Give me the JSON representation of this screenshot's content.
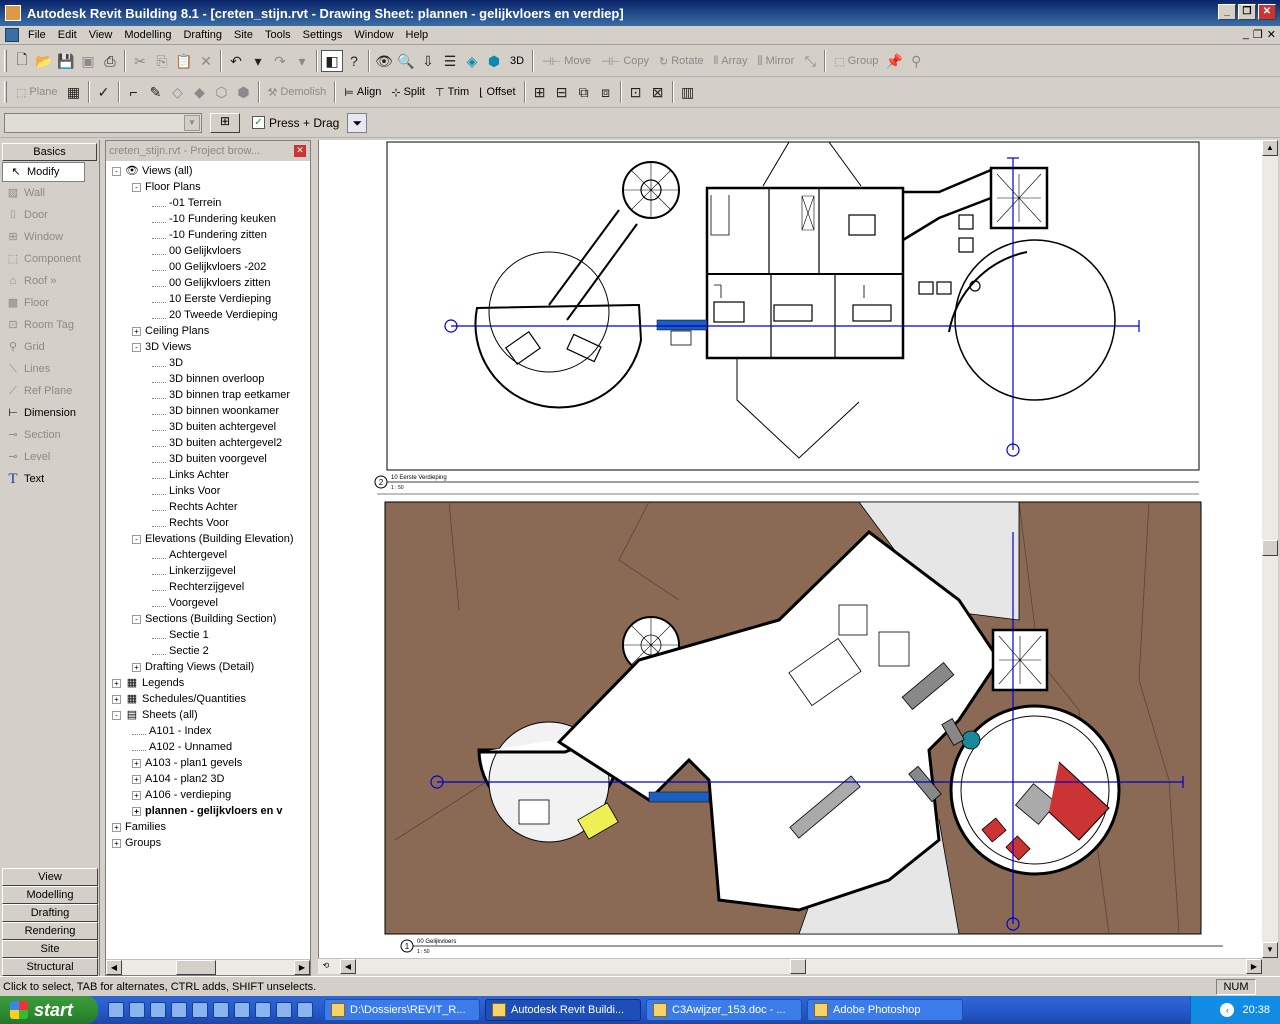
{
  "window": {
    "title": "Autodesk Revit Building 8.1 - [creten_stijn.rvt - Drawing Sheet: plannen - gelijkvloers en verdiep]"
  },
  "menu": [
    "File",
    "Edit",
    "View",
    "Modelling",
    "Drafting",
    "Site",
    "Tools",
    "Settings",
    "Window",
    "Help"
  ],
  "toolbar1": {
    "view3d_label": "3D",
    "move": "Move",
    "copy": "Copy",
    "rotate": "Rotate",
    "array": "Array",
    "mirror": "Mirror",
    "group": "Group"
  },
  "toolbar2": {
    "plane": "Plane",
    "demolish": "Demolish",
    "align": "Align",
    "split": "Split",
    "trim": "Trim",
    "offset": "Offset"
  },
  "options_bar": {
    "press_drag": "Press + Drag",
    "press_drag_checked": true
  },
  "design_bar": {
    "active_tab": "Basics",
    "tools": [
      {
        "label": "Modify",
        "icon": "arrow-cursor-icon",
        "enabled": true,
        "selected": true
      },
      {
        "label": "Wall",
        "icon": "wall-icon",
        "enabled": false
      },
      {
        "label": "Door",
        "icon": "door-icon",
        "enabled": false
      },
      {
        "label": "Window",
        "icon": "window-icon",
        "enabled": false
      },
      {
        "label": "Component",
        "icon": "component-icon",
        "enabled": false
      },
      {
        "label": "Roof »",
        "icon": "roof-icon",
        "enabled": false
      },
      {
        "label": "Floor",
        "icon": "floor-icon",
        "enabled": false
      },
      {
        "label": "Room Tag",
        "icon": "room-tag-icon",
        "enabled": false
      },
      {
        "label": "Grid",
        "icon": "grid-icon",
        "enabled": false
      },
      {
        "label": "Lines",
        "icon": "lines-icon",
        "enabled": false
      },
      {
        "label": "Ref Plane",
        "icon": "ref-plane-icon",
        "enabled": false
      },
      {
        "label": "Dimension",
        "icon": "dimension-icon",
        "enabled": true
      },
      {
        "label": "Section",
        "icon": "section-icon",
        "enabled": false
      },
      {
        "label": "Level",
        "icon": "level-icon",
        "enabled": false
      },
      {
        "label": "Text",
        "icon": "text-icon",
        "enabled": true
      }
    ],
    "bottom_tabs": [
      "View",
      "Modelling",
      "Drafting",
      "Rendering",
      "Site",
      "Structural"
    ]
  },
  "project_browser": {
    "title": "creten_stijn.rvt - Project brow...",
    "nodes": [
      {
        "label": "Views (all)",
        "depth": 0,
        "exp": "-",
        "icon": "eye-icon"
      },
      {
        "label": "Floor Plans",
        "depth": 1,
        "exp": "-"
      },
      {
        "label": "-01 Terrein",
        "depth": 2
      },
      {
        "label": "-10 Fundering keuken",
        "depth": 2
      },
      {
        "label": "-10 Fundering zitten",
        "depth": 2
      },
      {
        "label": "00 Gelijkvloers",
        "depth": 2
      },
      {
        "label": "00 Gelijkvloers -202",
        "depth": 2
      },
      {
        "label": "00 Gelijkvloers zitten",
        "depth": 2
      },
      {
        "label": "10 Eerste Verdieping",
        "depth": 2
      },
      {
        "label": "20 Tweede Verdieping",
        "depth": 2
      },
      {
        "label": "Ceiling Plans",
        "depth": 1,
        "exp": "+"
      },
      {
        "label": "3D Views",
        "depth": 1,
        "exp": "-"
      },
      {
        "label": "3D",
        "depth": 2
      },
      {
        "label": "3D binnen overloop",
        "depth": 2
      },
      {
        "label": "3D binnen trap eetkamer",
        "depth": 2
      },
      {
        "label": "3D binnen woonkamer",
        "depth": 2
      },
      {
        "label": "3D buiten achtergevel",
        "depth": 2
      },
      {
        "label": "3D buiten achtergevel2",
        "depth": 2
      },
      {
        "label": "3D buiten voorgevel",
        "depth": 2
      },
      {
        "label": "Links Achter",
        "depth": 2
      },
      {
        "label": "Links Voor",
        "depth": 2
      },
      {
        "label": "Rechts Achter",
        "depth": 2
      },
      {
        "label": "Rechts Voor",
        "depth": 2
      },
      {
        "label": "Elevations (Building Elevation)",
        "depth": 1,
        "exp": "-"
      },
      {
        "label": "Achtergevel",
        "depth": 2
      },
      {
        "label": "Linkerzijgevel",
        "depth": 2
      },
      {
        "label": "Rechterzijgevel",
        "depth": 2
      },
      {
        "label": "Voorgevel",
        "depth": 2
      },
      {
        "label": "Sections (Building Section)",
        "depth": 1,
        "exp": "-"
      },
      {
        "label": "Sectie 1",
        "depth": 2
      },
      {
        "label": "Sectie 2",
        "depth": 2
      },
      {
        "label": "Drafting Views (Detail)",
        "depth": 1,
        "exp": "+"
      },
      {
        "label": "Legends",
        "depth": 0,
        "exp": "+",
        "icon": "legend-icon"
      },
      {
        "label": "Schedules/Quantities",
        "depth": 0,
        "exp": "+",
        "icon": "schedule-icon"
      },
      {
        "label": "Sheets (all)",
        "depth": 0,
        "exp": "-",
        "icon": "sheet-icon"
      },
      {
        "label": "A101 - Index",
        "depth": 1
      },
      {
        "label": "A102 - Unnamed",
        "depth": 1
      },
      {
        "label": "A103 - plan1 gevels",
        "depth": 1,
        "exp": "+"
      },
      {
        "label": "A104 - plan2 3D",
        "depth": 1,
        "exp": "+"
      },
      {
        "label": "A106 - verdieping",
        "depth": 1,
        "exp": "+"
      },
      {
        "label": "plannen - gelijkvloers en v",
        "depth": 1,
        "exp": "+",
        "bold": true
      },
      {
        "label": "Families",
        "depth": 0,
        "exp": "+"
      },
      {
        "label": "Groups",
        "depth": 0,
        "exp": "+"
      }
    ]
  },
  "sheet": {
    "view_top": {
      "number": "2",
      "title": "10 Eerste Verdieping",
      "scale": "1 : 50"
    },
    "view_bottom": {
      "number": "1",
      "title": "00 Gelijkvloers",
      "scale": "1 : 50"
    },
    "colors": {
      "terrain": "#8b6a55",
      "grid_line": "#0000cc",
      "furniture_red": "#cc3333",
      "accent_yellow": "#eeee55",
      "teal": "#1a8a9a"
    }
  },
  "status": {
    "hint": "Click to select, TAB for alternates, CTRL adds, SHIFT unselects.",
    "num": "NUM"
  },
  "taskbar": {
    "start": "start",
    "tasks": [
      {
        "label": "D:\\Dossiers\\REVIT_R...",
        "active": false
      },
      {
        "label": "Autodesk Revit Buildi...",
        "active": true
      },
      {
        "label": "C3Awijzer_153.doc - ...",
        "active": false
      },
      {
        "label": "Adobe Photoshop",
        "active": false
      }
    ],
    "clock": "20:38"
  }
}
